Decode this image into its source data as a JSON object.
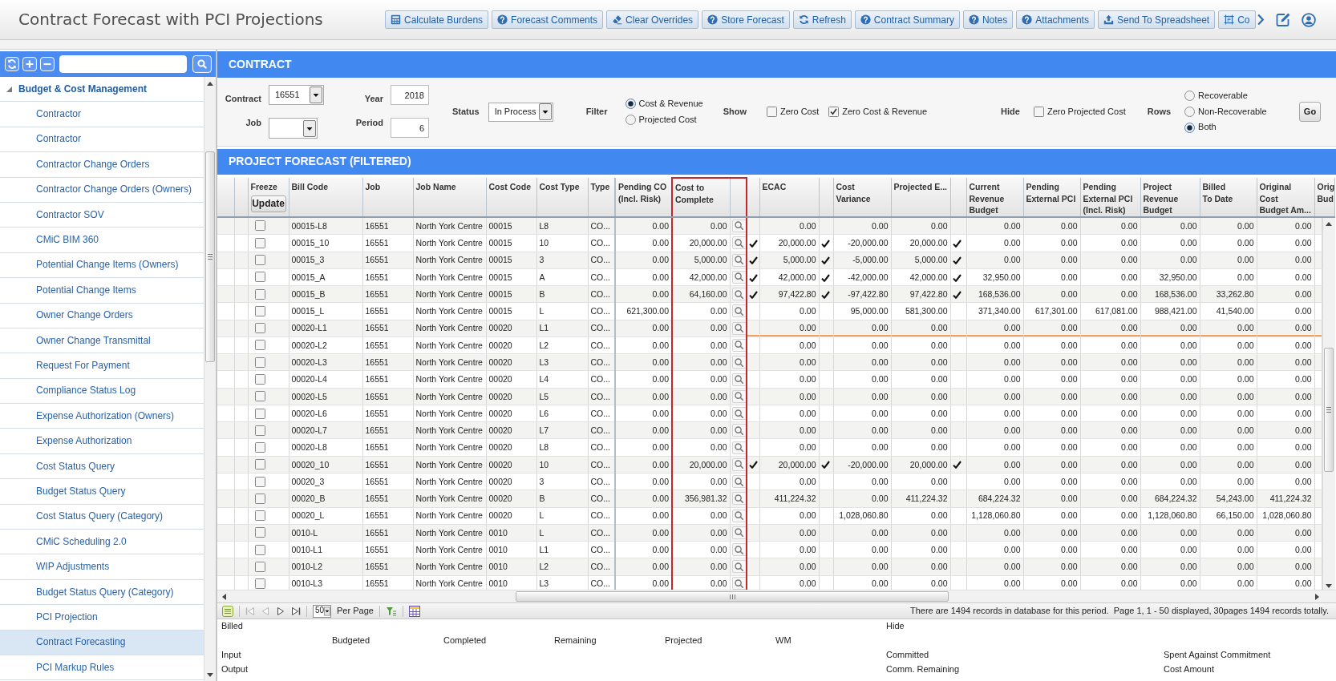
{
  "window": {
    "title": "Contract Forecast with PCI Projections"
  },
  "toolbar": {
    "buttons": [
      {
        "label": "Calculate Burdens",
        "kind": "calculate"
      },
      {
        "label": "Forecast Comments",
        "kind": "comment"
      },
      {
        "label": "Clear Overrides",
        "kind": "clear"
      },
      {
        "label": "Store Forecast",
        "kind": "store"
      },
      {
        "label": "Refresh",
        "kind": "refresh"
      },
      {
        "label": "Contract Summary",
        "kind": "summary"
      },
      {
        "label": "Notes",
        "kind": "notes"
      },
      {
        "label": "Attachments",
        "kind": "attachments"
      },
      {
        "label": "Send To Spreadsheet",
        "kind": "export"
      },
      {
        "label": "Co",
        "kind": "layout"
      }
    ]
  },
  "sidebar": {
    "tree": [
      {
        "label": "Budget & Cost Management",
        "expanded": true,
        "children": [
          {
            "label": "Contractor",
            "selected": false
          },
          {
            "label": "Contractor",
            "selected": false
          },
          {
            "label": "Contractor Change Orders",
            "selected": false
          },
          {
            "label": "Contractor Change Orders (Owners)",
            "selected": false
          },
          {
            "label": "Contractor SOV",
            "selected": false
          },
          {
            "label": "CMiC BIM 360",
            "selected": false
          },
          {
            "label": "Potential Change Items (Owners)",
            "selected": false
          },
          {
            "label": "Potential Change Items",
            "selected": false
          },
          {
            "label": "Owner Change Orders",
            "selected": false
          },
          {
            "label": "Owner Change Transmittal",
            "selected": false
          },
          {
            "label": "Request For Payment",
            "selected": false
          },
          {
            "label": "Compliance Status Log",
            "selected": false
          },
          {
            "label": "Expense Authorization (Owners)",
            "selected": false
          },
          {
            "label": "Expense Authorization",
            "selected": false
          },
          {
            "label": "Cost Status Query",
            "selected": false
          },
          {
            "label": "Budget Status Query",
            "selected": false
          },
          {
            "label": "Cost Status Query (Category)",
            "selected": false
          },
          {
            "label": "CMiC Scheduling 2.0",
            "selected": false
          },
          {
            "label": "WIP Adjustments",
            "selected": false
          },
          {
            "label": "Budget Status Query (Category)",
            "selected": false
          },
          {
            "label": "PCI Projection",
            "selected": false
          },
          {
            "label": "Contract Forecasting",
            "selected": true
          },
          {
            "label": "PCI Markup Rules",
            "selected": false
          }
        ]
      }
    ]
  },
  "contract_panel": {
    "title": "CONTRACT",
    "contract": {
      "label": "Contract",
      "value": "16551"
    },
    "job": {
      "label": "Job"
    },
    "year": {
      "label": "Year",
      "value": "2018"
    },
    "period": {
      "label": "Period",
      "value": "6"
    },
    "status": {
      "label": "Status",
      "value": "In Process"
    },
    "filter": {
      "label": "Filter",
      "options": [
        {
          "label": "Cost & Revenue",
          "selected": true
        },
        {
          "label": "Projected Cost",
          "selected": false
        }
      ]
    },
    "show": {
      "label": "Show",
      "options": [
        {
          "label": "Zero Cost",
          "checked": false
        },
        {
          "label": "Zero Cost & Revenue",
          "checked": true
        }
      ]
    },
    "hide": {
      "label": "Hide",
      "options": [
        {
          "label": "Zero Projected Cost",
          "checked": false
        }
      ]
    },
    "rows": {
      "label": "Rows",
      "options": [
        {
          "label": "Recoverable",
          "selected": false
        },
        {
          "label": "Non-Recoverable",
          "selected": false
        },
        {
          "label": "Both",
          "selected": true
        }
      ]
    },
    "go_button": "Go"
  },
  "forecast": {
    "title": "PROJECT FORECAST (FILTERED)",
    "columns": [
      {
        "kind": "freeze",
        "label": "Freeze",
        "button": "Update",
        "highlighted": false
      },
      {
        "kind": "text",
        "label": "Bill Code",
        "highlighted": false
      },
      {
        "kind": "text",
        "label": "Job",
        "highlighted": false
      },
      {
        "kind": "text",
        "label": "Job Name",
        "highlighted": false
      },
      {
        "kind": "text",
        "label": "Cost Code",
        "highlighted": false
      },
      {
        "kind": "link",
        "label": "Cost Type",
        "highlighted": false
      },
      {
        "kind": "text",
        "label": "Type",
        "highlighted": false
      },
      {
        "kind": "amount",
        "label": "Pending CO\n(Incl. Risk)",
        "highlighted": false
      },
      {
        "kind": "amount",
        "label": "Cost to\nComplete",
        "highlighted": true
      },
      {
        "kind": "lookup",
        "highlighted": true
      },
      {
        "kind": "flag",
        "highlighted": false
      },
      {
        "kind": "amount",
        "label": "ECAC",
        "highlighted": false
      },
      {
        "kind": "flag",
        "highlighted": false
      },
      {
        "kind": "amount",
        "label": "Cost\nVariance",
        "highlighted": false
      },
      {
        "kind": "amount",
        "label": "Projected E...",
        "highlighted": false
      },
      {
        "kind": "flag",
        "highlighted": false
      },
      {
        "kind": "amount_link",
        "label": "Current\nRevenue\nBudget",
        "highlighted": false
      },
      {
        "kind": "amount_link",
        "label": "Pending\nExternal PCI",
        "highlighted": false
      },
      {
        "kind": "amount",
        "label": "Pending\nExternal PCI\n(Incl. Risk)",
        "highlighted": false
      },
      {
        "kind": "amount_link",
        "label": "Project\nRevenue\nBudget",
        "highlighted": false
      },
      {
        "kind": "amount_link",
        "label": "Billed\nTo Date",
        "highlighted": false
      },
      {
        "kind": "amount",
        "label": "Original Cost\nBudget Am...",
        "highlighted": false
      },
      {
        "kind": "cut",
        "label": "Orig\nBud",
        "highlighted": false
      }
    ],
    "rows": [
      {
        "selected": false,
        "cells": [
          false,
          "00015-L8",
          "16551",
          "North York Centre",
          "00015",
          "L8",
          "CO...",
          "0.00",
          "0.00",
          "",
          false,
          "0.00",
          false,
          "0.00",
          "0.00",
          false,
          "0.00",
          "0.00",
          "0.00",
          "0.00",
          "0.00",
          "0.00"
        ]
      },
      {
        "selected": false,
        "cells": [
          false,
          "00015_10",
          "16551",
          "North York Centre",
          "00015",
          "10",
          "CO...",
          "0.00",
          "20,000.00",
          "",
          true,
          "20,000.00",
          true,
          "-20,000.00",
          "20,000.00",
          true,
          "0.00",
          "0.00",
          "0.00",
          "0.00",
          "0.00",
          "0.00"
        ]
      },
      {
        "selected": false,
        "cells": [
          false,
          "00015_3",
          "16551",
          "North York Centre",
          "00015",
          "3",
          "CO...",
          "0.00",
          "5,000.00",
          "",
          true,
          "5,000.00",
          true,
          "-5,000.00",
          "5,000.00",
          true,
          "0.00",
          "0.00",
          "0.00",
          "0.00",
          "0.00",
          "0.00"
        ]
      },
      {
        "selected": false,
        "cells": [
          false,
          "00015_A",
          "16551",
          "North York Centre",
          "00015",
          "A",
          "CO...",
          "0.00",
          "42,000.00",
          "",
          true,
          "42,000.00",
          true,
          "-42,000.00",
          "42,000.00",
          true,
          "32,950.00",
          "0.00",
          "0.00",
          "32,950.00",
          "0.00",
          "0.00"
        ]
      },
      {
        "selected": false,
        "cells": [
          false,
          "00015_B",
          "16551",
          "North York Centre",
          "00015",
          "B",
          "CO...",
          "0.00",
          "64,160.00",
          "",
          true,
          "97,422.80",
          true,
          "-97,422.80",
          "97,422.80",
          true,
          "168,536.00",
          "0.00",
          "0.00",
          "168,536.00",
          "33,262.80",
          "0.00"
        ]
      },
      {
        "selected": false,
        "cells": [
          false,
          "00015_L",
          "16551",
          "North York Centre",
          "00015",
          "L",
          "CO...",
          "621,300.00",
          "0.00",
          "",
          false,
          "0.00",
          false,
          "95,000.00",
          "581,300.00",
          false,
          "371,340.00",
          "617,301.00",
          "617,081.00",
          "988,421.00",
          "41,540.00",
          "0.00"
        ]
      },
      {
        "selected": true,
        "cells": [
          false,
          "00020-L1",
          "16551",
          "North York Centre",
          "00020",
          "L1",
          "CO...",
          "0.00",
          "0.00",
          "",
          false,
          "0.00",
          false,
          "0.00",
          "0.00",
          false,
          "0.00",
          "0.00",
          "0.00",
          "0.00",
          "0.00",
          "0.00"
        ]
      },
      {
        "selected": false,
        "cells": [
          false,
          "00020-L2",
          "16551",
          "North York Centre",
          "00020",
          "L2",
          "CO...",
          "0.00",
          "0.00",
          "",
          false,
          "0.00",
          false,
          "0.00",
          "0.00",
          false,
          "0.00",
          "0.00",
          "0.00",
          "0.00",
          "0.00",
          "0.00"
        ]
      },
      {
        "selected": false,
        "cells": [
          false,
          "00020-L3",
          "16551",
          "North York Centre",
          "00020",
          "L3",
          "CO...",
          "0.00",
          "0.00",
          "",
          false,
          "0.00",
          false,
          "0.00",
          "0.00",
          false,
          "0.00",
          "0.00",
          "0.00",
          "0.00",
          "0.00",
          "0.00"
        ]
      },
      {
        "selected": false,
        "cells": [
          false,
          "00020-L4",
          "16551",
          "North York Centre",
          "00020",
          "L4",
          "CO...",
          "0.00",
          "0.00",
          "",
          false,
          "0.00",
          false,
          "0.00",
          "0.00",
          false,
          "0.00",
          "0.00",
          "0.00",
          "0.00",
          "0.00",
          "0.00"
        ]
      },
      {
        "selected": false,
        "cells": [
          false,
          "00020-L5",
          "16551",
          "North York Centre",
          "00020",
          "L5",
          "CO...",
          "0.00",
          "0.00",
          "",
          false,
          "0.00",
          false,
          "0.00",
          "0.00",
          false,
          "0.00",
          "0.00",
          "0.00",
          "0.00",
          "0.00",
          "0.00"
        ]
      },
      {
        "selected": false,
        "cells": [
          false,
          "00020-L6",
          "16551",
          "North York Centre",
          "00020",
          "L6",
          "CO...",
          "0.00",
          "0.00",
          "",
          false,
          "0.00",
          false,
          "0.00",
          "0.00",
          false,
          "0.00",
          "0.00",
          "0.00",
          "0.00",
          "0.00",
          "0.00"
        ]
      },
      {
        "selected": false,
        "cells": [
          false,
          "00020-L7",
          "16551",
          "North York Centre",
          "00020",
          "L7",
          "CO...",
          "0.00",
          "0.00",
          "",
          false,
          "0.00",
          false,
          "0.00",
          "0.00",
          false,
          "0.00",
          "0.00",
          "0.00",
          "0.00",
          "0.00",
          "0.00"
        ]
      },
      {
        "selected": false,
        "cells": [
          false,
          "00020-L8",
          "16551",
          "North York Centre",
          "00020",
          "L8",
          "CO...",
          "0.00",
          "0.00",
          "",
          false,
          "0.00",
          false,
          "0.00",
          "0.00",
          false,
          "0.00",
          "0.00",
          "0.00",
          "0.00",
          "0.00",
          "0.00"
        ]
      },
      {
        "selected": false,
        "cells": [
          false,
          "00020_10",
          "16551",
          "North York Centre",
          "00020",
          "10",
          "CO...",
          "0.00",
          "20,000.00",
          "",
          true,
          "20,000.00",
          true,
          "-20,000.00",
          "20,000.00",
          true,
          "0.00",
          "0.00",
          "0.00",
          "0.00",
          "0.00",
          "0.00"
        ]
      },
      {
        "selected": false,
        "cells": [
          false,
          "00020_3",
          "16551",
          "North York Centre",
          "00020",
          "3",
          "CO...",
          "0.00",
          "0.00",
          "",
          false,
          "0.00",
          false,
          "0.00",
          "0.00",
          false,
          "0.00",
          "0.00",
          "0.00",
          "0.00",
          "0.00",
          "0.00"
        ]
      },
      {
        "selected": false,
        "cells": [
          false,
          "00020_B",
          "16551",
          "North York Centre",
          "00020",
          "B",
          "CO...",
          "0.00",
          "356,981.32",
          "",
          false,
          "411,224.32",
          false,
          "0.00",
          "411,224.32",
          false,
          "684,224.32",
          "0.00",
          "0.00",
          "684,224.32",
          "54,243.00",
          "411,224.32"
        ]
      },
      {
        "selected": false,
        "cells": [
          false,
          "00020_L",
          "16551",
          "North York Centre",
          "00020",
          "L",
          "CO...",
          "0.00",
          "0.00",
          "",
          false,
          "0.00",
          false,
          "1,028,060.80",
          "0.00",
          false,
          "1,128,060.80",
          "0.00",
          "0.00",
          "1,128,060.80",
          "66,150.00",
          "1,028,060.80"
        ]
      },
      {
        "selected": false,
        "cells": [
          false,
          "0010-L",
          "16551",
          "North York Centre",
          "0010",
          "L",
          "CO...",
          "0.00",
          "0.00",
          "",
          false,
          "0.00",
          false,
          "0.00",
          "0.00",
          false,
          "0.00",
          "0.00",
          "0.00",
          "0.00",
          "0.00",
          "0.00"
        ]
      },
      {
        "selected": false,
        "cells": [
          false,
          "0010-L1",
          "16551",
          "North York Centre",
          "0010",
          "L1",
          "CO...",
          "0.00",
          "0.00",
          "",
          false,
          "0.00",
          false,
          "0.00",
          "0.00",
          false,
          "0.00",
          "0.00",
          "0.00",
          "0.00",
          "0.00",
          "0.00"
        ]
      },
      {
        "selected": false,
        "cells": [
          false,
          "0010-L2",
          "16551",
          "North York Centre",
          "0010",
          "L2",
          "CO...",
          "0.00",
          "0.00",
          "",
          false,
          "0.00",
          false,
          "0.00",
          "0.00",
          false,
          "0.00",
          "0.00",
          "0.00",
          "0.00",
          "0.00",
          "0.00"
        ]
      },
      {
        "selected": false,
        "cells": [
          false,
          "0010-L3",
          "16551",
          "North York Centre",
          "0010",
          "L3",
          "CO...",
          "0.00",
          "0.00",
          "",
          false,
          "0.00",
          false,
          "0.00",
          "0.00",
          false,
          "0.00",
          "0.00",
          "0.00",
          "0.00",
          "0.00",
          "0.00"
        ]
      }
    ]
  },
  "pager": {
    "buttons": [
      {
        "kind": "first",
        "disabled": true
      },
      {
        "kind": "previous",
        "disabled": true
      },
      {
        "kind": "next",
        "disabled": false
      },
      {
        "kind": "last",
        "disabled": false
      }
    ],
    "per_page": "50",
    "per_page_label": "Per Page",
    "info": "There are 1494 records in database for this period.  Page 1, 1 - 50 displayed, 30pages 1494 records totally."
  },
  "summary": {
    "title": "Billed",
    "hide_link": "Hide",
    "headings": [
      "Budgeted",
      "Completed",
      "Remaining",
      "Projected",
      "WM"
    ],
    "lines": [
      {
        "label": "Input",
        "middle": "Committed",
        "right": "Spent Against Commitment"
      },
      {
        "label": "Output",
        "middle": "Comm. Remaining",
        "right": "Cost Amount"
      }
    ]
  }
}
